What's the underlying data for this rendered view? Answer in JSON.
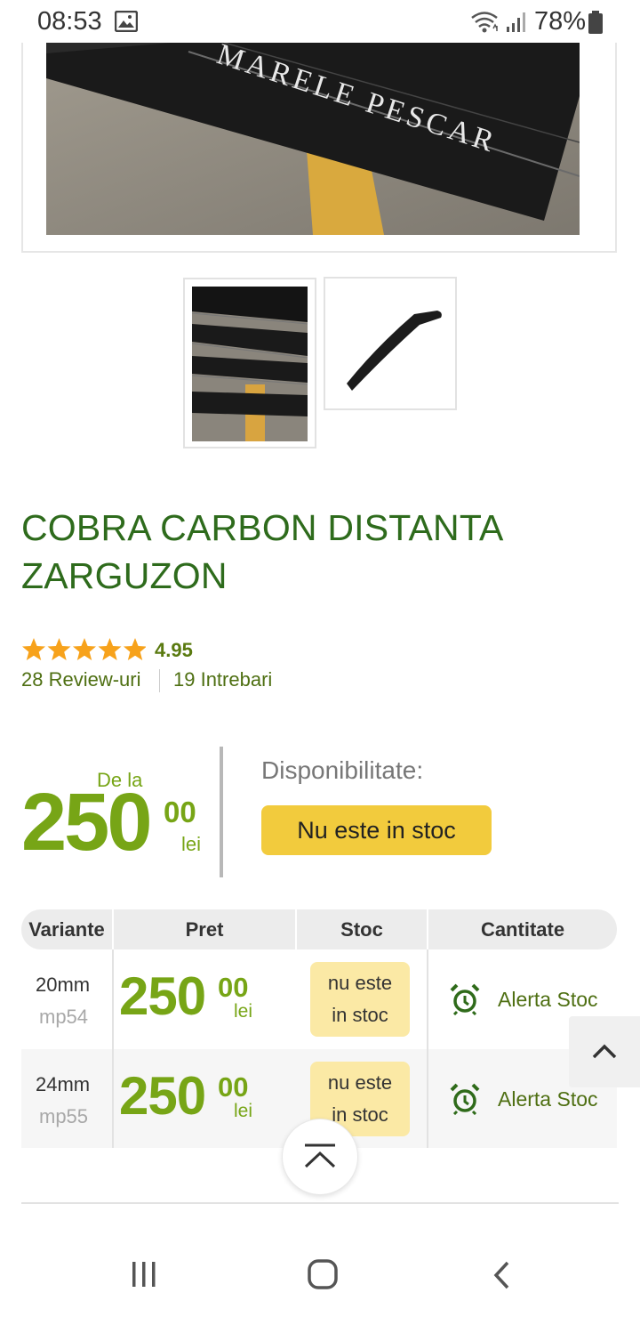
{
  "status_bar": {
    "time": "08:53",
    "battery": "78%"
  },
  "product": {
    "title": "COBRA CARBON DISTANTA ZARGUZON",
    "rating_value": "4.95",
    "stars": 5,
    "reviews_label": "28 Review-uri",
    "questions_label": "19 Intrebari"
  },
  "price": {
    "from_label": "De la",
    "integer": "250",
    "decimals": "00",
    "currency": "lei"
  },
  "availability": {
    "label": "Disponibilitate:",
    "status": "Nu este in stoc"
  },
  "table": {
    "headers": [
      "Variante",
      "Pret",
      "Stoc",
      "Cantitate"
    ],
    "rows": [
      {
        "size": "20mm",
        "code": "mp54",
        "price_int": "250",
        "price_dec": "00",
        "currency": "lei",
        "stock_line1": "nu este",
        "stock_line2": "in stoc",
        "action": "Alerta Stoc"
      },
      {
        "size": "24mm",
        "code": "mp55",
        "price_int": "250",
        "price_dec": "00",
        "currency": "lei",
        "stock_line1": "nu este",
        "stock_line2": "in stoc",
        "action": "Alerta Stoc"
      }
    ]
  },
  "icons": {
    "status_gallery": "image-icon",
    "status_wifi": "wifi-icon",
    "status_signal": "signal-icon",
    "status_battery": "battery-icon",
    "rating": "star-icon",
    "alert": "alarm-clock-icon",
    "scroll_up": "chevron-up-icon",
    "scroll_top": "scroll-to-top-icon",
    "nav_recents": "recent-apps-icon",
    "nav_home": "home-icon",
    "nav_back": "back-icon"
  },
  "colors": {
    "brand_green": "#2e6b1c",
    "price_green": "#77a516",
    "badge_yellow": "#f2cb3d",
    "stock_badge": "#fbe9a5",
    "star": "#f7a21b"
  }
}
